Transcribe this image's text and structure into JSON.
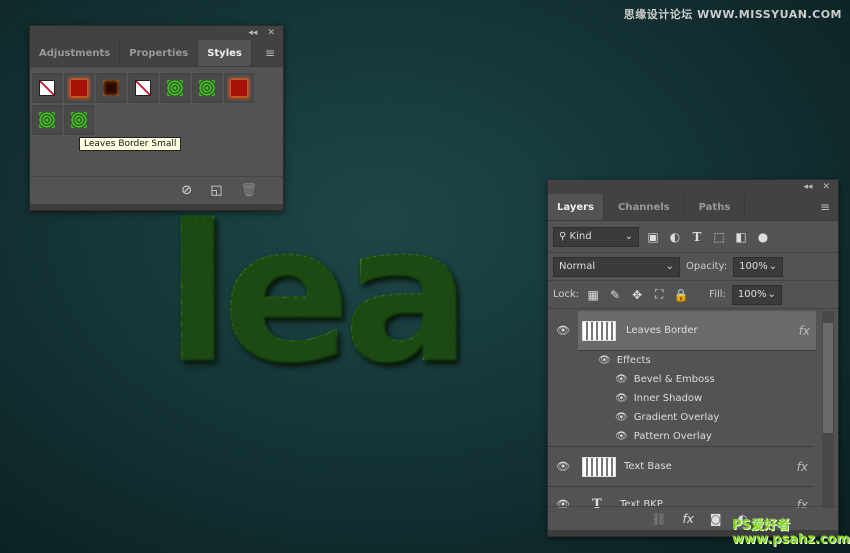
{
  "watermark_top": "思缘设计论坛 WWW.MISSYUAN.COM",
  "watermark_bottom": "PS爱好者 www.psahz.com",
  "canvas_text": "lea",
  "styles_panel": {
    "tabs": [
      {
        "label": "Adjustments"
      },
      {
        "label": "Properties"
      },
      {
        "label": "Styles",
        "active": true
      }
    ],
    "swatches": [
      "none",
      "red-glow",
      "burnt",
      "none",
      "leaves",
      "leaves",
      "red-glow",
      "leaves",
      "leaves-small"
    ],
    "tooltip": "Leaves Border Small",
    "footer_icons": [
      "clear-style-icon",
      "new-style-icon",
      "trash-icon"
    ]
  },
  "layers_panel": {
    "tabs": [
      {
        "label": "Layers",
        "active": true
      },
      {
        "label": "Channels"
      },
      {
        "label": "Paths"
      }
    ],
    "filter": {
      "value": "Kind"
    },
    "blend_mode": "Normal",
    "opacity_label": "Opacity:",
    "opacity": "100%",
    "lock_label": "Lock:",
    "fill_label": "Fill:",
    "fill": "100%",
    "layers": [
      {
        "name": "Leaves Border",
        "selected": true,
        "effects_label": "Effects",
        "effects": [
          "Bevel & Emboss",
          "Inner Shadow",
          "Gradient Overlay",
          "Pattern Overlay"
        ]
      },
      {
        "name": "Text Base"
      },
      {
        "name": "Text BKP",
        "type": "text"
      }
    ]
  }
}
